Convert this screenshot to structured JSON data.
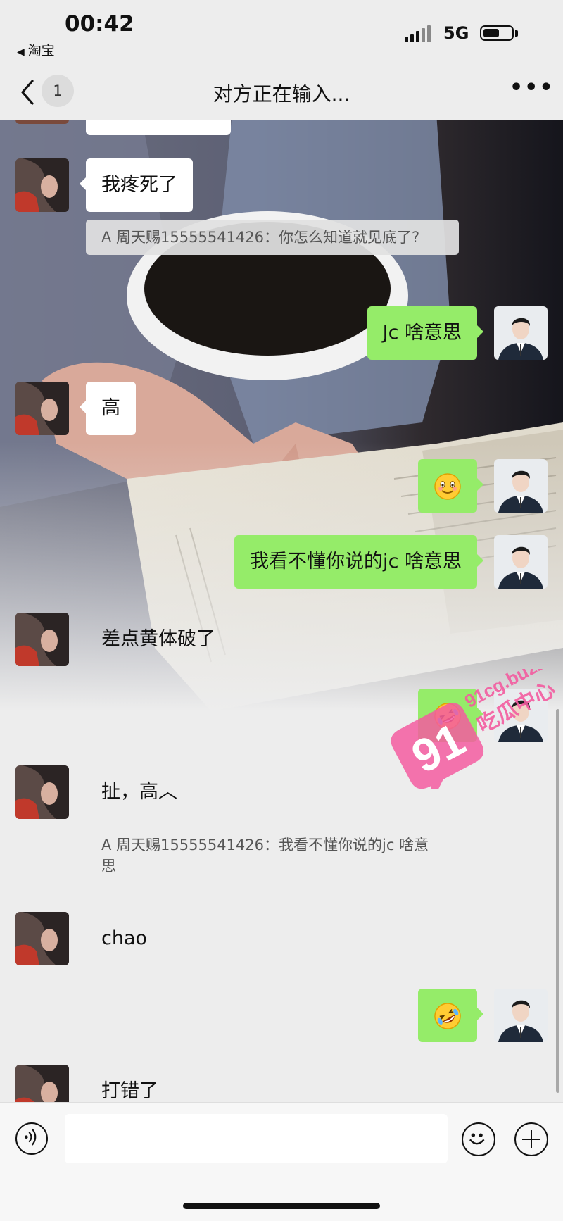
{
  "status_bar": {
    "time": "00:42",
    "back_app": "淘宝",
    "network": "5G",
    "battery_level": 0.5
  },
  "nav": {
    "unread_count": "1",
    "title": "对方正在输入...",
    "icons": [
      "chevron-left-icon",
      "more-icon"
    ]
  },
  "messages": [
    {
      "from": "her",
      "type": "text",
      "text": "我疼死了"
    },
    {
      "from": "her",
      "type": "quote",
      "text": "A 周天赐15555541426：你怎么知道就见底了?"
    },
    {
      "from": "me",
      "type": "text",
      "text": "Jc 啥意思"
    },
    {
      "from": "her",
      "type": "text",
      "text": "高"
    },
    {
      "from": "me",
      "type": "emoji",
      "emoji": "drooling-face-emoji"
    },
    {
      "from": "me",
      "type": "text",
      "text": "我看不懂你说的jc 啥意思"
    },
    {
      "from": "her",
      "type": "text",
      "text": "差点黄体破了"
    },
    {
      "from": "me",
      "type": "emoji",
      "emoji": "rolling-laughing-emoji"
    },
    {
      "from": "her",
      "type": "text",
      "text": "扯，高︿"
    },
    {
      "from": "her",
      "type": "quote",
      "text": "A 周天赐15555541426：我看不懂你说的jc 啥意思"
    },
    {
      "from": "her",
      "type": "text",
      "text": "chao"
    },
    {
      "from": "me",
      "type": "emoji",
      "emoji": "rolling-laughing-emoji"
    },
    {
      "from": "her",
      "type": "text",
      "text": "打错了"
    }
  ],
  "watermark": {
    "logo_number": "91",
    "site": "91cg.buzz",
    "name": "吃瓜中心"
  },
  "input_bar": {
    "icons": [
      "voice-icon",
      "emoji-icon",
      "plus-icon"
    ],
    "placeholder": ""
  },
  "colors": {
    "background": "#ededed",
    "my_bubble": "#95ec69",
    "her_bubble": "#ffffff",
    "watermark_pink": "#f35ca0"
  }
}
